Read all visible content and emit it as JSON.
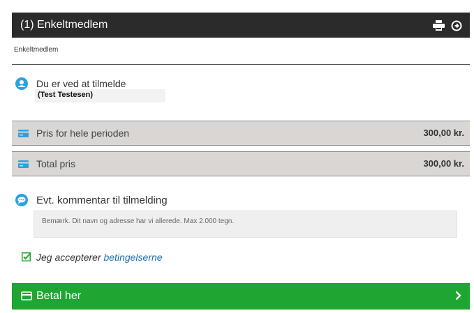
{
  "header": {
    "title": "(1) Enkeltmedlem",
    "print_icon": "print-icon",
    "back_icon": "circle-arrow-icon"
  },
  "subtitle": "Enkeltmedlem",
  "signup": {
    "text": "Du er ved at tilmelde",
    "name": "(Test Testesen)",
    "icon": "user-icon"
  },
  "prices": [
    {
      "label": "Pris for hele perioden",
      "value": "300,00 kr.",
      "icon": "credit-card-icon"
    },
    {
      "label": "Total pris",
      "value": "300,00 kr.",
      "icon": "credit-card-icon"
    }
  ],
  "comment": {
    "label": "Evt. kommentar til tilmelding",
    "placeholder": "Bemærk. Dit navn og adresse har vi allerede. Max 2.000 tegn.",
    "value": "",
    "icon": "comment-icon"
  },
  "accept": {
    "text": "Jeg accepterer",
    "link": "betingelserne",
    "checked": true
  },
  "pay": {
    "label": "Betal her",
    "icon": "credit-card-icon",
    "arrow": "chevron-right-icon"
  },
  "colors": {
    "header_bg": "#2b2b2b",
    "accent_blue": "#29a3e0",
    "pay_green": "#1ea632",
    "row_bg": "#d9d6d4",
    "link": "#1a6fb3"
  }
}
